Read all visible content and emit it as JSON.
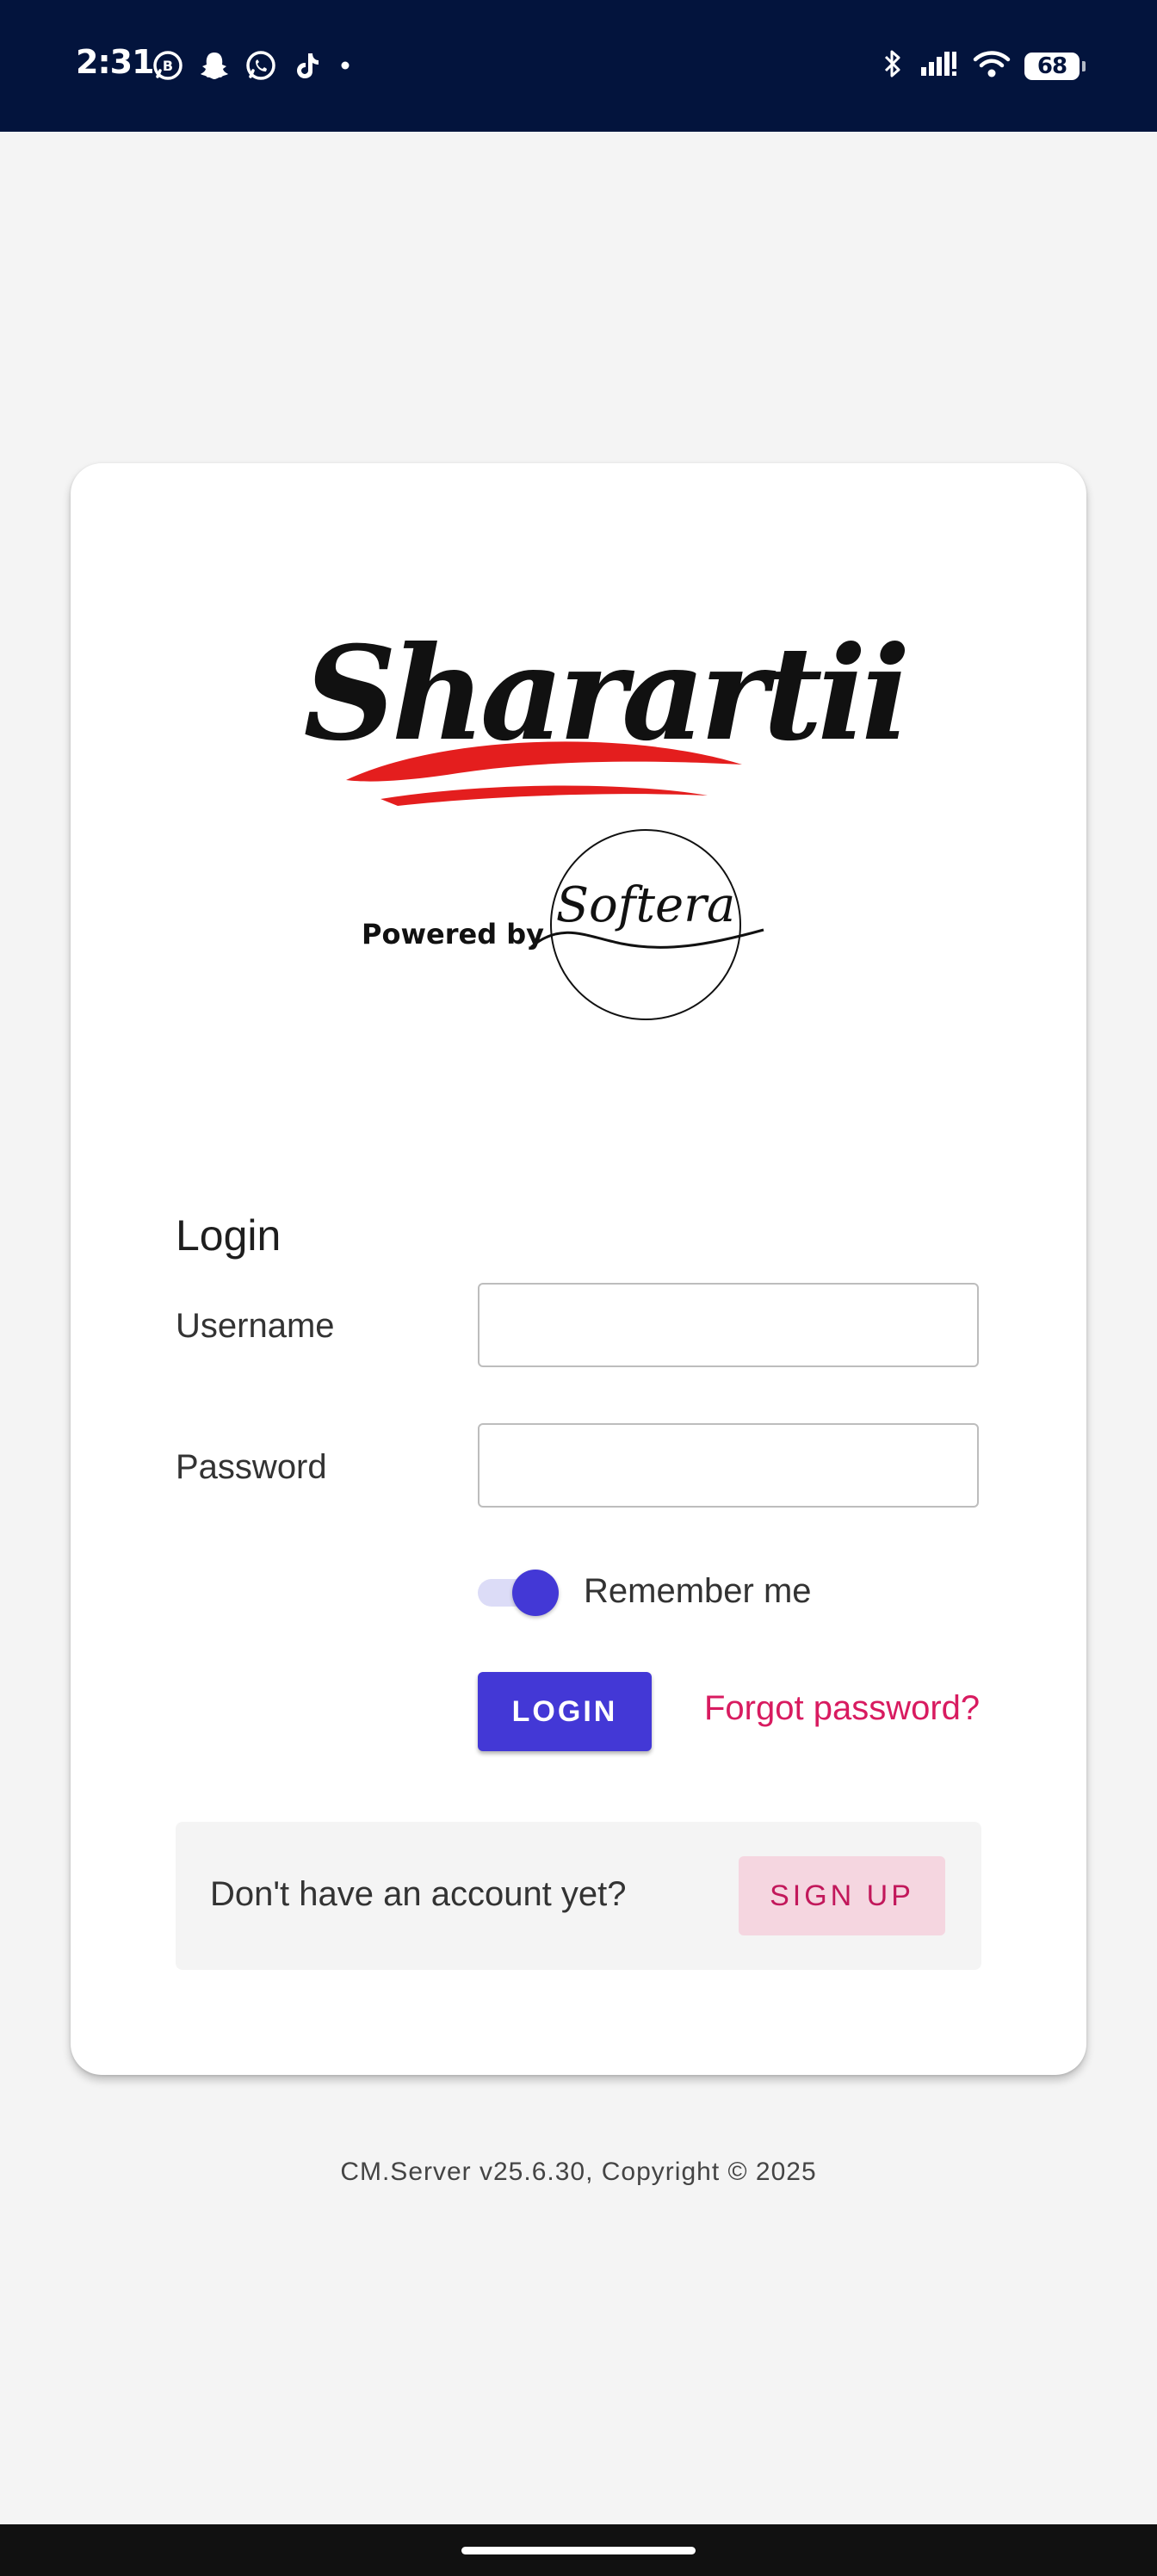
{
  "status_bar": {
    "time": "2:31",
    "battery": "68",
    "notification_icons": [
      "whatsapp-business-icon",
      "snapchat-icon",
      "whatsapp-icon",
      "tiktok-icon",
      "more-dot-icon"
    ],
    "system_icons": [
      "bluetooth-icon",
      "signal-icon",
      "wifi-icon",
      "battery-icon"
    ]
  },
  "logo": {
    "brand_wordmark": "Sharartii",
    "powered_by": "Powered by",
    "partner_wordmark": "Softera",
    "colors": {
      "black": "#111111",
      "red": "#e41e1e"
    }
  },
  "login_form": {
    "heading": "Login",
    "username_label": "Username",
    "username_value": "",
    "password_label": "Password",
    "password_value": "",
    "remember_label": "Remember me",
    "remember_checked": true,
    "login_button": "LOGIN",
    "forgot_link": "Forgot password?"
  },
  "signup": {
    "prompt": "Don't have an account yet?",
    "button": "SIGN UP"
  },
  "footer": {
    "text": "CM.Server v25.6.30, Copyright © 2025"
  },
  "theme": {
    "primary": "#4338d6",
    "accent": "#d81b60",
    "status_bar": "#03143d",
    "background": "#f4f4f4"
  }
}
